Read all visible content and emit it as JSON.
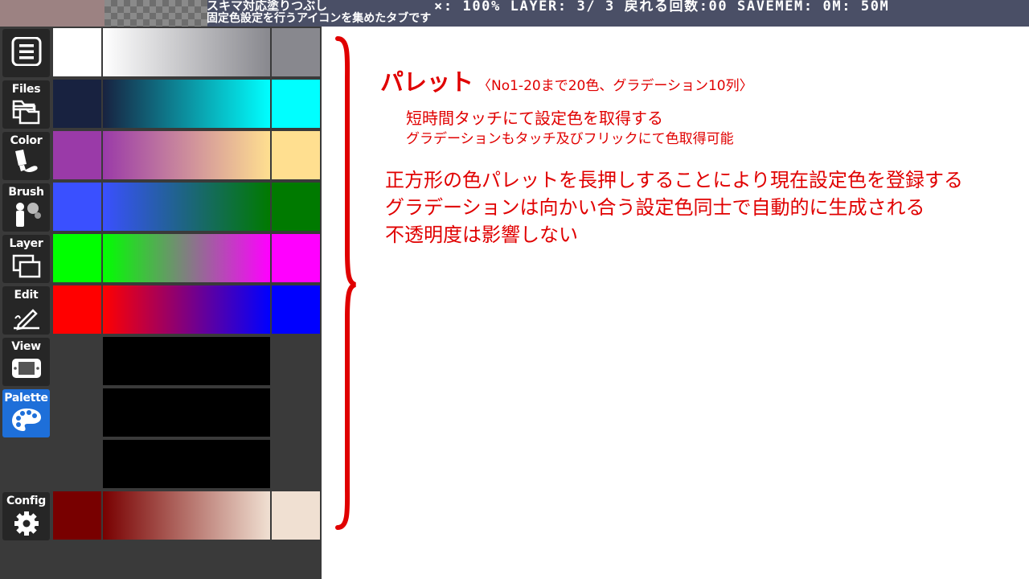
{
  "status_bar": {
    "app_title": "スキマ対応塗りつぶし",
    "tab_hint": "固定色設定を行うアイコンを集めたタブです",
    "status_line": "×:  100%  LAYER:  3/ 3 戻れる回数:00 SAVEMEM:   0M: 50M",
    "preview_color": "#9c8282"
  },
  "toolbar": {
    "items": [
      {
        "label": "",
        "icon": "menu-icon"
      },
      {
        "label": "Files",
        "icon": "folder-icon"
      },
      {
        "label": "Color",
        "icon": "paint-tube-icon"
      },
      {
        "label": "Brush",
        "icon": "spray-brush-icon"
      },
      {
        "label": "Layer",
        "icon": "layers-icon"
      },
      {
        "label": "Edit",
        "icon": "pen-edit-icon"
      },
      {
        "label": "View",
        "icon": "handheld-view-icon"
      },
      {
        "label": "Palette",
        "icon": "palette-icon",
        "active": true
      },
      {
        "label": "Config",
        "icon": "gear-icon"
      }
    ],
    "active_color": "#1e6fd9"
  },
  "palette": {
    "rows": [
      {
        "left": "#ffffff",
        "right": "#88888e"
      },
      {
        "left": "#182240",
        "right": "#00ffff"
      },
      {
        "left": "#9a3aa8",
        "right": "#ffdf90"
      },
      {
        "left": "#3a50ff",
        "right": "#007a00"
      },
      {
        "left": "#00ff00",
        "right": "#ff00ff"
      },
      {
        "left": "#ff0000",
        "right": "#0000ff"
      },
      {
        "left": null,
        "right": null
      },
      {
        "left": null,
        "right": null
      },
      {
        "left": null,
        "right": null
      },
      {
        "left": "#780000",
        "right": "#f0e0d2"
      }
    ]
  },
  "annotations": {
    "palette_title": "パレット",
    "palette_subtitle": "〈No1-20まで20色、グラデーション10列〉",
    "note_tap": "短時間タッチにて設定色を取得する",
    "note_gradient_tap": "グラデーションもタッチ及びフリックにて色取得可能",
    "note_long_press": "正方形の色パレットを長押しすることにより現在設定色を登録する",
    "note_gradient_auto": "グラデーションは向かい合う設定色同士で自動的に生成される",
    "note_opacity": "不透明度は影響しない",
    "accent_color": "#e00000"
  }
}
